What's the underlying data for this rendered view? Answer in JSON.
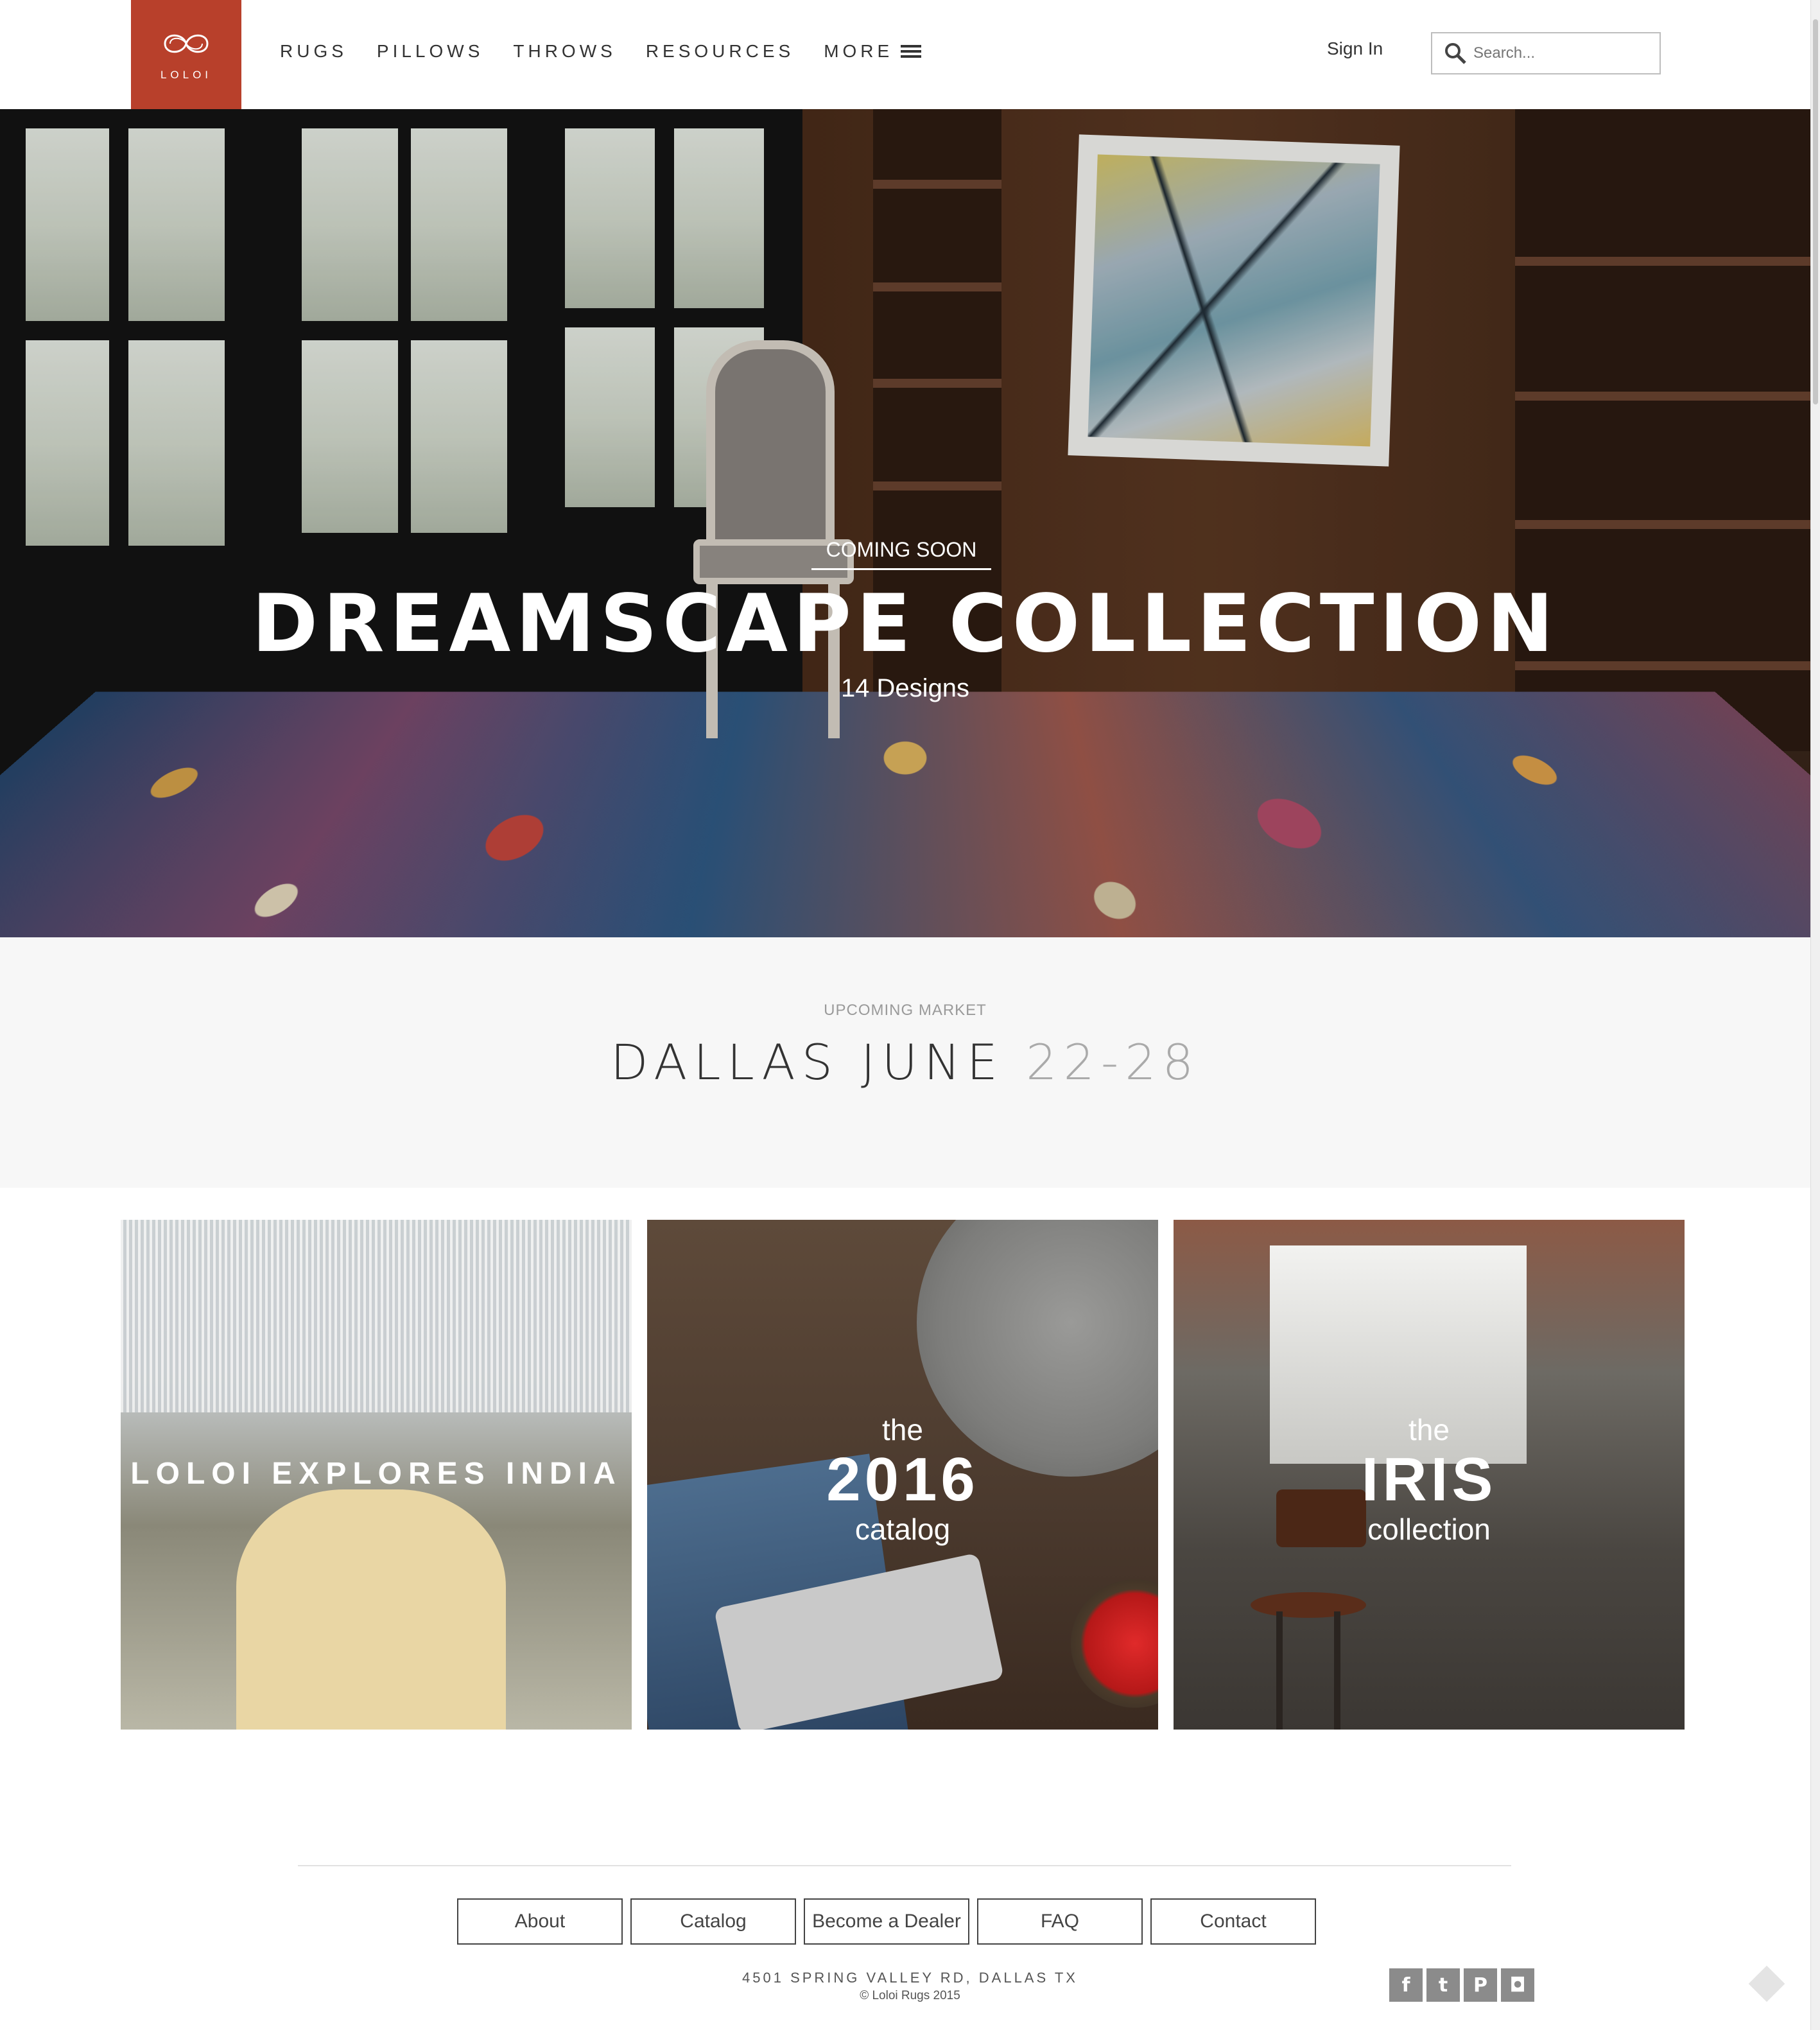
{
  "header": {
    "logo_text": "LOLOI",
    "logo_color": "#b8402b",
    "nav": [
      {
        "label": "RUGS"
      },
      {
        "label": "PILLOWS"
      },
      {
        "label": "THROWS"
      },
      {
        "label": "RESOURCES"
      },
      {
        "label": "MORE"
      }
    ],
    "signin": "Sign In",
    "search_placeholder": "Search...",
    "search_icon": "search-icon",
    "menu_icon": "hamburger-icon"
  },
  "hero": {
    "eyebrow": "COMING SOON",
    "title": "DREAMSCAPE COLLECTION",
    "subtitle": "14 Designs"
  },
  "market": {
    "label": "UPCOMING MARKET",
    "city_month": "DALLAS JUNE",
    "dates": "22-28"
  },
  "tiles": [
    {
      "text": "LOLOI EXPLORES INDIA"
    },
    {
      "line1": "the",
      "line2": "2016",
      "line3": "catalog"
    },
    {
      "line1": "the",
      "line2": "IRIS",
      "line3": "collection"
    }
  ],
  "footer": {
    "buttons": [
      "About",
      "Catalog",
      "Become a Dealer",
      "FAQ",
      "Contact"
    ],
    "address": "4501 SPRING VALLEY RD, DALLAS TX",
    "copyright": "© Loloi Rugs 2015",
    "social": [
      {
        "icon": "facebook-icon",
        "glyph": "f"
      },
      {
        "icon": "twitter-icon",
        "glyph": "t"
      },
      {
        "icon": "pinterest-icon",
        "glyph": "P"
      },
      {
        "icon": "instagram-icon",
        "glyph": "◘"
      }
    ]
  }
}
